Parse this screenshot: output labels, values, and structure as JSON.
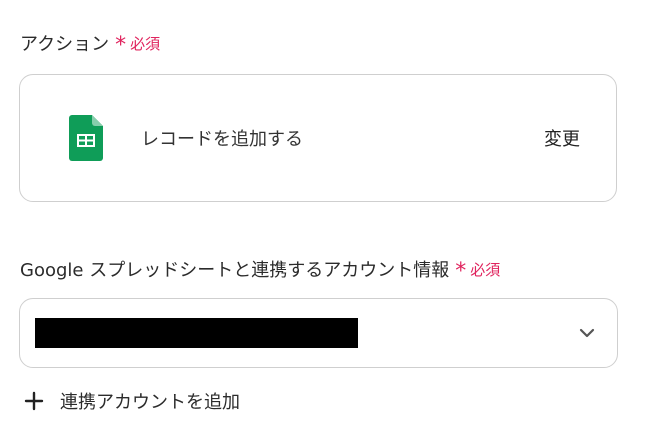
{
  "action_section": {
    "label": "アクション",
    "required_mark": "*",
    "required_text": "必須"
  },
  "action_card": {
    "icon": "google-sheets-icon",
    "action_name": "レコードを追加する",
    "change_label": "変更"
  },
  "account_section": {
    "label": "Google スプレッドシートと連携するアカウント情報",
    "required_mark": "*",
    "required_text": "必須"
  },
  "account_select": {
    "selected_value": "",
    "dropdown_icon": "chevron-down-icon"
  },
  "add_account": {
    "icon": "plus-icon",
    "label": "連携アカウントを追加"
  },
  "colors": {
    "required": "#e0245e",
    "sheets_green": "#0f9d58",
    "border": "#cfcfcf"
  }
}
